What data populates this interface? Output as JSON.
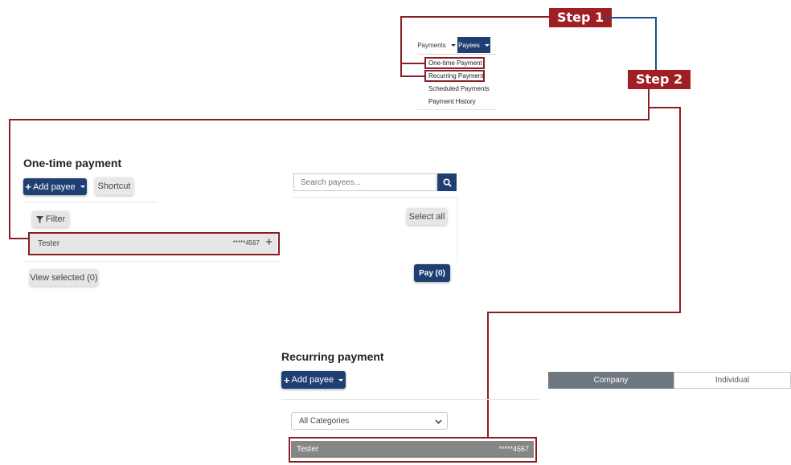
{
  "steps": {
    "step1": "Step 1",
    "step2": "Step 2"
  },
  "nav": {
    "payments_label": "Payments",
    "payees_label": "Payees",
    "menu_items": [
      "One-time Payment",
      "Recurring Payment",
      "Scheduled Payments",
      "Payment History"
    ]
  },
  "one_time": {
    "title": "One-time payment",
    "add_payee_label": "Add payee",
    "shortcut_label": "Shortcut",
    "filter_label": "Filter",
    "search_placeholder": "Search payees...",
    "select_all_label": "Select all",
    "payee_row": {
      "name": "Tester",
      "account": "*****4567"
    },
    "view_selected_label": "View selected (0)",
    "pay_label": "Pay (0)"
  },
  "recurring": {
    "title": "Recurring payment",
    "add_payee_label": "Add payee",
    "tabs": [
      "Company",
      "Individual"
    ],
    "category_selected": "All Categories",
    "payee_row": {
      "name": "Tester",
      "account": "*****4567"
    }
  },
  "colors": {
    "accent_red": "#a01f24",
    "primary_blue": "#1f3f73",
    "tab_active": "#6f7880"
  }
}
